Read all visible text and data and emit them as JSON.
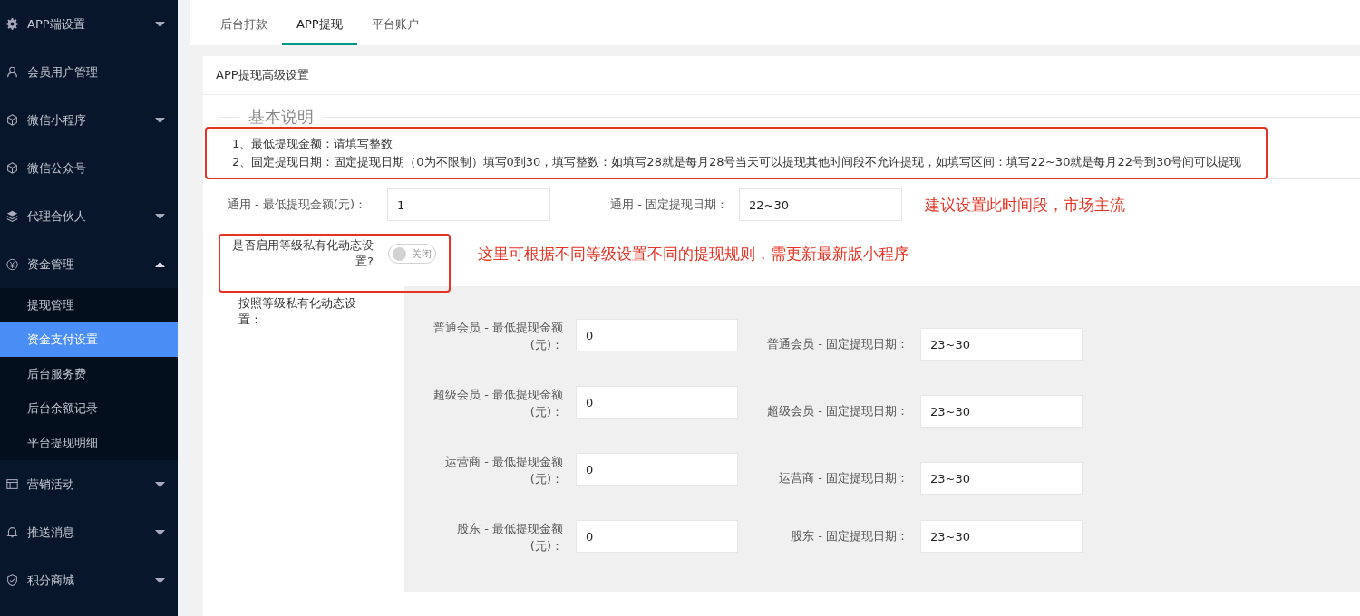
{
  "sidebar": {
    "items": [
      {
        "label": "APP端设置",
        "expanded": false
      },
      {
        "label": "会员用户管理"
      },
      {
        "label": "微信小程序",
        "expanded": false
      },
      {
        "label": "微信公众号"
      },
      {
        "label": "代理合伙人",
        "expanded": false
      },
      {
        "label": "资金管理",
        "expanded": true,
        "children": [
          {
            "label": "提现管理",
            "selected": false
          },
          {
            "label": "资金支付设置",
            "selected": true
          },
          {
            "label": "后台服务费",
            "selected": false
          },
          {
            "label": "后台余额记录",
            "selected": false
          },
          {
            "label": "平台提现明细",
            "selected": false
          }
        ]
      },
      {
        "label": "营销活动",
        "expanded": false
      },
      {
        "label": "推送消息",
        "expanded": false
      },
      {
        "label": "积分商城",
        "expanded": false
      }
    ]
  },
  "tabs": [
    {
      "label": "后台打款",
      "selected": false
    },
    {
      "label": "APP提现",
      "selected": true
    },
    {
      "label": "平台账户",
      "selected": false
    }
  ],
  "card": {
    "title": "APP提现高级设置",
    "notes": {
      "legend": "基本说明",
      "lines": [
        "1、最低提现金额：请填写整数",
        "2、固定提现日期：固定提现日期（0为不限制）填写0到30，填写整数：如填写28就是每月28号当天可以提现其他时间段不允许提现，如填写区间：填写22~30就是每月22号到30号间可以提现"
      ]
    },
    "general": [
      {
        "label": "通用 - 最低提现金额(元)：",
        "value": "1"
      },
      {
        "label": "通用 - 固定提现日期：",
        "value": "22~30"
      }
    ],
    "general_annotation": "建议设置此时间段，市场主流",
    "toggle": {
      "label": "是否启用等级私有化动态设置?",
      "on": false,
      "text": "关闭"
    },
    "toggle_annotation": "这里可根据不同等级设置不同的提现规则，需更新最新版小程序",
    "levels_label": "按照等级私有化动态设置：",
    "levels": [
      {
        "min_label": "普通会员 - 最低提现金额(元)：",
        "min_value": "0",
        "date_label": "普通会员 - 固定提现日期：",
        "date_value": "23~30"
      },
      {
        "min_label": "超级会员 - 最低提现金额(元)：",
        "min_value": "0",
        "date_label": "超级会员 - 固定提现日期：",
        "date_value": "23~30"
      },
      {
        "min_label": "运营商 - 最低提现金额(元)：",
        "min_value": "0",
        "date_label": "运营商 - 固定提现日期：",
        "date_value": "23~30"
      },
      {
        "min_label": "股东 - 最低提现金额(元)：",
        "min_value": "0",
        "date_label": "股东 - 固定提现日期：",
        "date_value": "23~30"
      }
    ]
  }
}
